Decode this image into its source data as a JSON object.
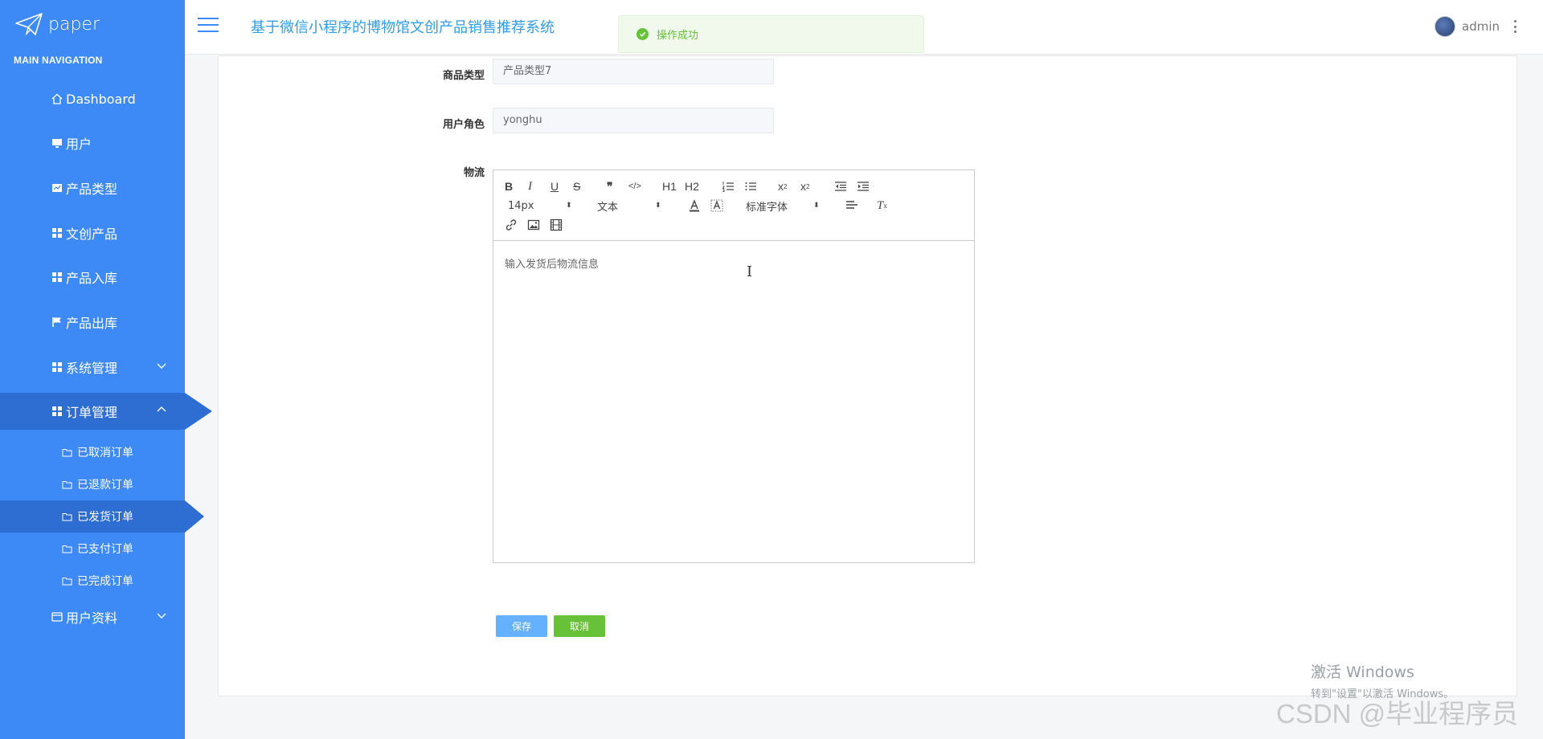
{
  "brand": {
    "name": "paper",
    "icon": "paper-plane-icon"
  },
  "sidebar": {
    "section_title": "MAIN NAVIGATION",
    "items": [
      {
        "label": "Dashboard",
        "icon": "home-icon"
      },
      {
        "label": "用户",
        "icon": "monitor-icon"
      },
      {
        "label": "产品类型",
        "icon": "chart-icon"
      },
      {
        "label": "文创产品",
        "icon": "grid-icon"
      },
      {
        "label": "产品入库",
        "icon": "grid-icon"
      },
      {
        "label": "产品出库",
        "icon": "flag-icon"
      },
      {
        "label": "系统管理",
        "icon": "grid-icon",
        "expandable": true,
        "expanded": false
      },
      {
        "label": "订单管理",
        "icon": "grid-icon",
        "expandable": true,
        "expanded": true,
        "active": true
      },
      {
        "label": "用户资料",
        "icon": "card-icon",
        "expandable": true,
        "expanded": false
      }
    ],
    "order_subitems": [
      {
        "label": "已取消订单",
        "icon": "folder-icon"
      },
      {
        "label": "已退款订单",
        "icon": "folder-icon"
      },
      {
        "label": "已发货订单",
        "icon": "folder-icon",
        "active": true
      },
      {
        "label": "已支付订单",
        "icon": "folder-icon"
      },
      {
        "label": "已完成订单",
        "icon": "folder-icon"
      }
    ]
  },
  "header": {
    "title": "基于微信小程序的博物馆文创产品销售推荐系统",
    "user": "admin"
  },
  "toast": {
    "message": "操作成功",
    "type": "success"
  },
  "form": {
    "product_type_label": "商品类型",
    "product_type_value": "产品类型7",
    "user_role_label": "用户角色",
    "user_role_value": "yonghu",
    "logistics_label": "物流"
  },
  "editor": {
    "toolbar": {
      "bold": "B",
      "italic": "I",
      "underline": "U",
      "strike": "S",
      "quote": "❞",
      "code": "</>",
      "h1": "H1",
      "h2": "H2",
      "font_size": "14px",
      "header_select": "文本",
      "font_family": "标准字体"
    },
    "placeholder": "输入发货后物流信息"
  },
  "buttons": {
    "save": "保存",
    "cancel": "取消"
  },
  "colors": {
    "sidebar": "#3d8af7",
    "sidebar_active": "#2e6ed3",
    "title": "#2f9ee8",
    "save": "#66b1ff",
    "cancel": "#67c23a"
  },
  "overlay": {
    "win_line1": "激活 Windows",
    "win_line2": "转到\"设置\"以激活 Windows。",
    "csdn": "CSDN @毕业程序员"
  }
}
